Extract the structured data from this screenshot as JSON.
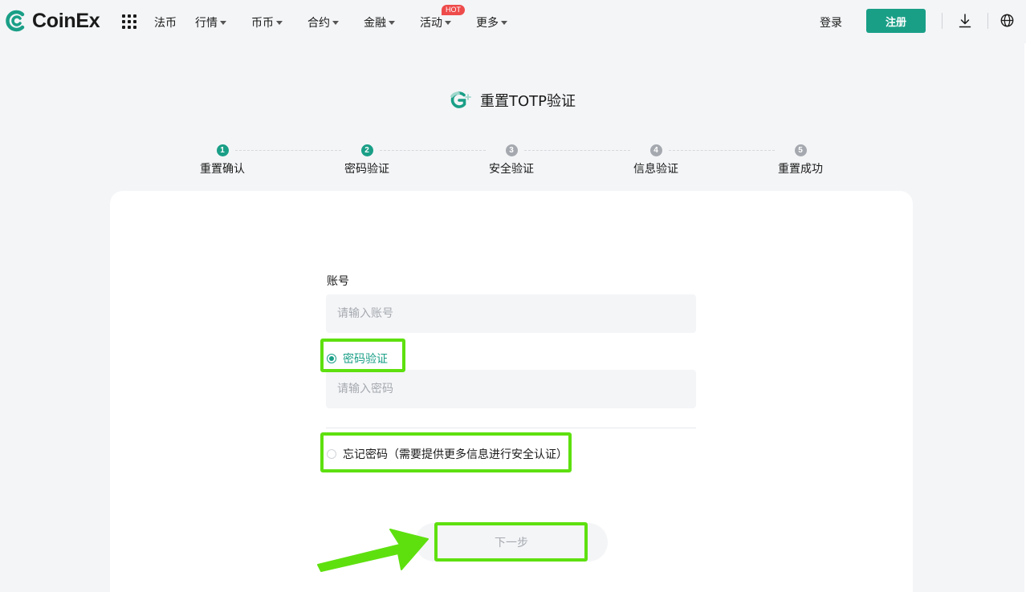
{
  "brand": {
    "name": "CoinEx",
    "accent": "#1a9f87"
  },
  "nav": {
    "items": [
      {
        "label": "法币",
        "dropdown": false
      },
      {
        "label": "行情",
        "dropdown": true
      },
      {
        "label": "币币",
        "dropdown": true
      },
      {
        "label": "合约",
        "dropdown": true
      },
      {
        "label": "金融",
        "dropdown": true
      },
      {
        "label": "活动",
        "dropdown": true
      },
      {
        "label": "更多",
        "dropdown": true
      }
    ],
    "hot_badge": "HOT",
    "login": "登录",
    "register": "注册"
  },
  "page": {
    "title": "重置TOTP验证"
  },
  "steps": [
    {
      "num": "1",
      "label": "重置确认",
      "active": true
    },
    {
      "num": "2",
      "label": "密码验证",
      "active": true
    },
    {
      "num": "3",
      "label": "安全验证",
      "active": false
    },
    {
      "num": "4",
      "label": "信息验证",
      "active": false
    },
    {
      "num": "5",
      "label": "重置成功",
      "active": false
    }
  ],
  "form": {
    "account_label": "账号",
    "account_placeholder": "请输入账号",
    "option_password": "密码验证",
    "password_placeholder": "请输入密码",
    "option_forgot": "忘记密码（需要提供更多信息进行安全认证）",
    "next": "下一步"
  },
  "colors": {
    "highlight": "#5ee00f",
    "hot": "#ee4b4b"
  }
}
